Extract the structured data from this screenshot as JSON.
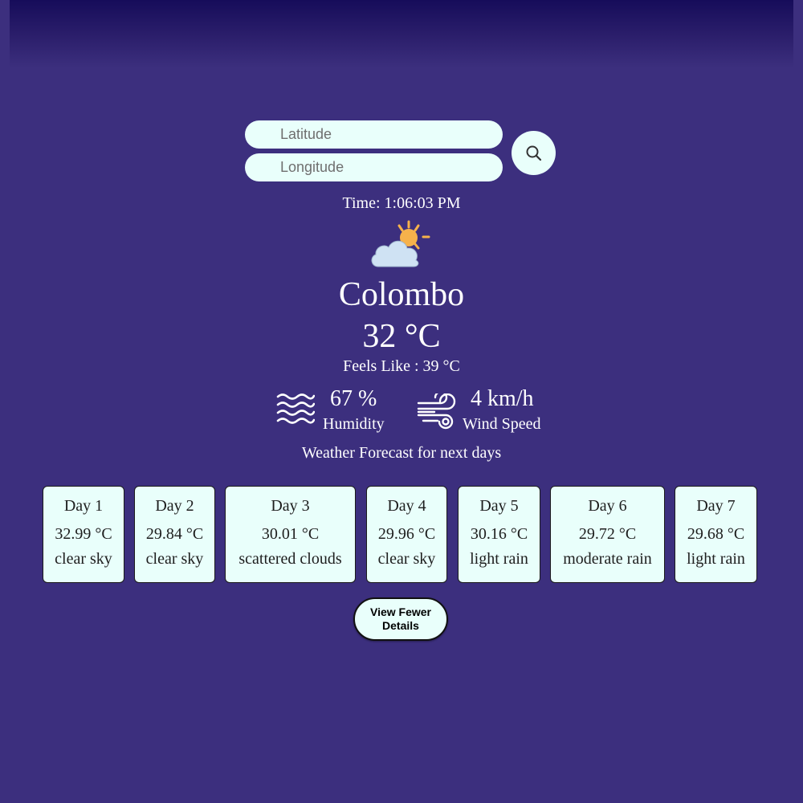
{
  "search": {
    "latitude_placeholder": "Latitude",
    "longitude_placeholder": "Longitude",
    "latitude_value": "",
    "longitude_value": "",
    "button_icon": "search-icon"
  },
  "current": {
    "time_label": "Time: 1:06:03 PM",
    "condition_icon": "partly-cloudy-icon",
    "city": "Colombo",
    "temperature": "32 °C",
    "feels_like": "Feels Like : 39 °C",
    "humidity_value": "67 %",
    "humidity_label": "Humidity",
    "humidity_icon": "humidity-waves-icon",
    "wind_value": "4 km/h",
    "wind_label": "Wind Speed",
    "wind_icon": "wind-icon"
  },
  "forecast": {
    "title": "Weather Forecast for next days",
    "days": [
      {
        "day": "Day 1",
        "temp": "32.99 °C",
        "desc": "clear sky"
      },
      {
        "day": "Day 2",
        "temp": "29.84 °C",
        "desc": "clear sky"
      },
      {
        "day": "Day 3",
        "temp": "30.01 °C",
        "desc": "scattered clouds"
      },
      {
        "day": "Day 4",
        "temp": "29.96 °C",
        "desc": "clear sky"
      },
      {
        "day": "Day 5",
        "temp": "30.16 °C",
        "desc": "light rain"
      },
      {
        "day": "Day 6",
        "temp": "29.72 °C",
        "desc": "moderate rain"
      },
      {
        "day": "Day 7",
        "temp": "29.68 °C",
        "desc": "light rain"
      }
    ],
    "toggle_label": "View Fewer Details"
  },
  "colors": {
    "background": "#3c2f7e",
    "header_band": "#160c5a",
    "card_background": "#e9fffb",
    "sun": "#f6b24b",
    "cloud": "#cfe2f3",
    "text": "#ffffff"
  }
}
